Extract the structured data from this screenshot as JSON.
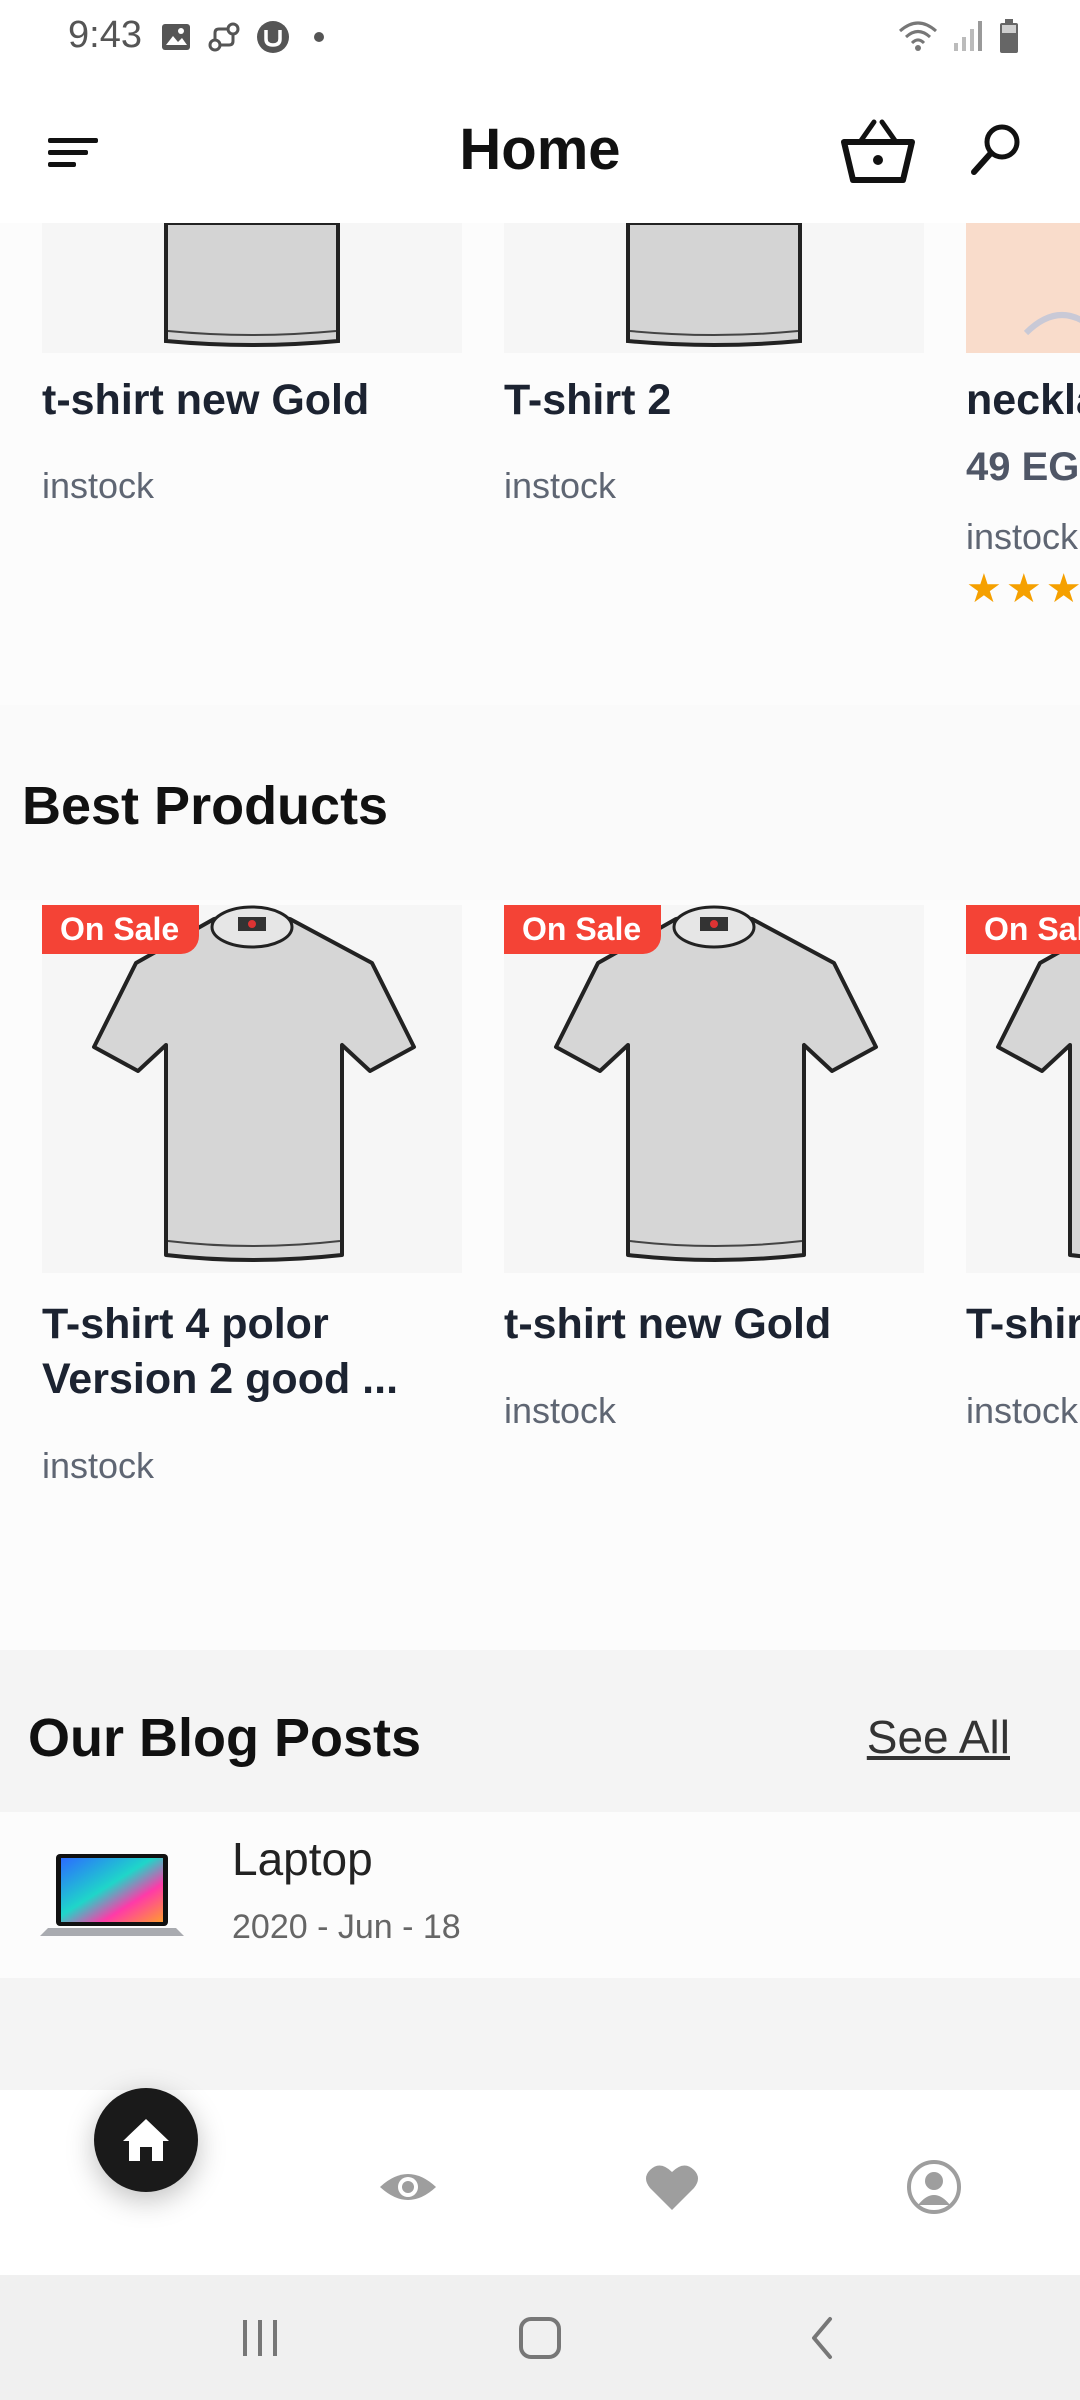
{
  "status_bar": {
    "time": "9:43",
    "icons_left": [
      "image-icon",
      "link-icon",
      "app-u-icon",
      "dot-icon"
    ],
    "icons_right": [
      "wifi-icon",
      "signal-icon",
      "battery-icon"
    ]
  },
  "app_bar": {
    "title": "Home",
    "icons": [
      "menu-icon",
      "cart-icon",
      "search-icon"
    ]
  },
  "top_products": [
    {
      "title": "t-shirt new Gold",
      "stock": "instock"
    },
    {
      "title": "T-shirt 2",
      "stock": "instock"
    },
    {
      "title": "neckla",
      "price": "49 EG",
      "stock": "instock",
      "rating": 3
    }
  ],
  "best_products": {
    "heading": "Best Products",
    "items": [
      {
        "badge": "On Sale",
        "title": "T-shirt 4 polor Version 2 good ...",
        "stock": "instock"
      },
      {
        "badge": "On Sale",
        "title": "t-shirt new Gold",
        "stock": "instock"
      },
      {
        "badge": "On Sal",
        "title": "T-shir",
        "stock": "instock"
      }
    ]
  },
  "blog": {
    "heading": "Our Blog Posts",
    "see_all": "See All",
    "posts": [
      {
        "title": "Laptop",
        "date": "2020 - Jun - 18"
      }
    ]
  },
  "bottom_nav": {
    "items": [
      "home-icon",
      "eye-icon",
      "heart-icon",
      "profile-icon"
    ],
    "active": "home-icon"
  },
  "colors": {
    "sale_badge": "#f44336",
    "star": "#f5a000",
    "nav_active": "#1a1a1a",
    "nav_inactive": "#9e9e9e"
  }
}
